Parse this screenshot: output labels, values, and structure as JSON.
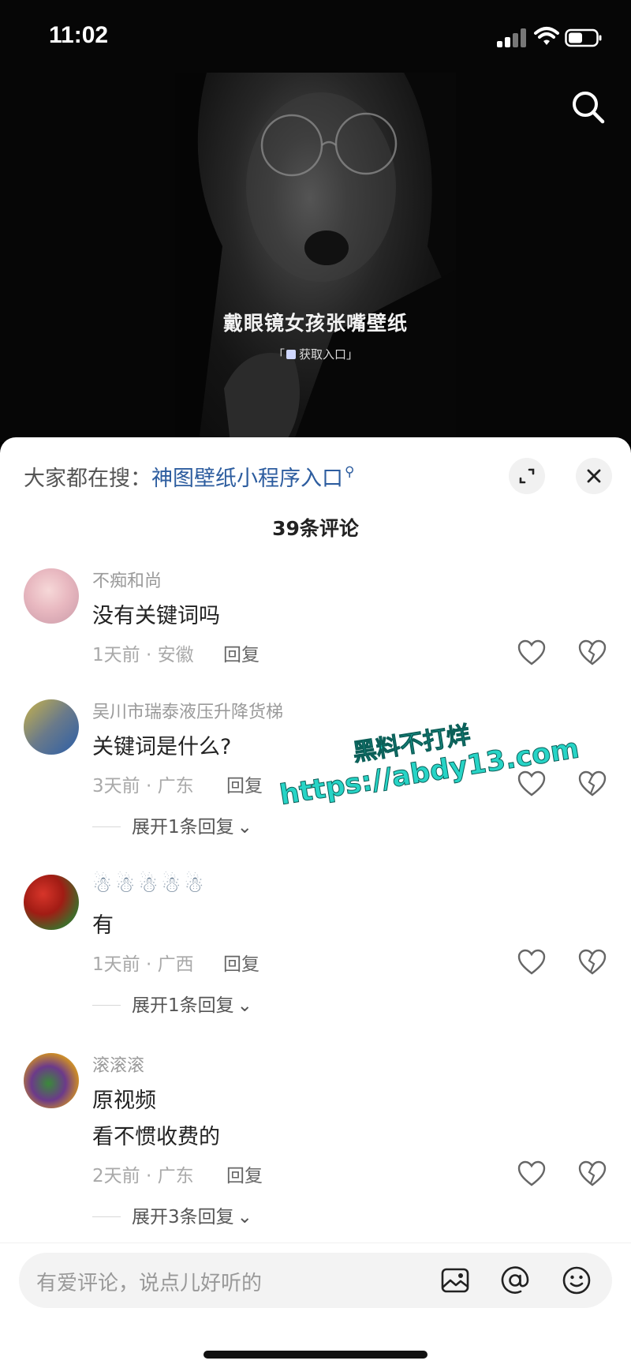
{
  "status_bar": {
    "time": "11:02"
  },
  "video": {
    "title": "戴眼镜女孩张嘴壁纸",
    "subtitle_left": "「",
    "subtitle_text": "获取入口",
    "subtitle_right": "」"
  },
  "sheet": {
    "search_prefix": "大家都在搜：",
    "search_keyword": "神图壁纸小程序入口",
    "comment_count": "39条评论"
  },
  "comments": [
    {
      "user": "不痴和尚",
      "text": "没有关键词吗",
      "meta": "1天前 · 安徽",
      "reply": "回复"
    },
    {
      "user": "吴川市瑞泰液压升降货梯",
      "text": "关键词是什么?",
      "meta": "3天前 · 广东",
      "reply": "回复",
      "expand": "展开1条回复"
    },
    {
      "user": "☃☃☃☃☃",
      "text": "有",
      "meta": "1天前 · 广西",
      "reply": "回复",
      "expand": "展开1条回复"
    },
    {
      "user": "滚滚滚",
      "text": "原视频",
      "text2": "看不惯收费的",
      "meta": "2天前 · 广东",
      "reply": "回复",
      "expand": "展开3条回复"
    }
  ],
  "watermark": {
    "line1": "黑料不打烊",
    "line2": "https://abdy13.com"
  },
  "input": {
    "placeholder": "有爱评论，说点儿好听的"
  },
  "icons": {
    "search": "search-icon",
    "expand": "expand-icon",
    "close": "close-icon",
    "like": "heart-icon",
    "dislike": "broken-heart-icon",
    "image": "image-icon",
    "mention": "at-icon",
    "emoji": "emoji-icon"
  },
  "colors": {
    "link": "#2d5d9f",
    "watermark": "#27d4c6"
  }
}
